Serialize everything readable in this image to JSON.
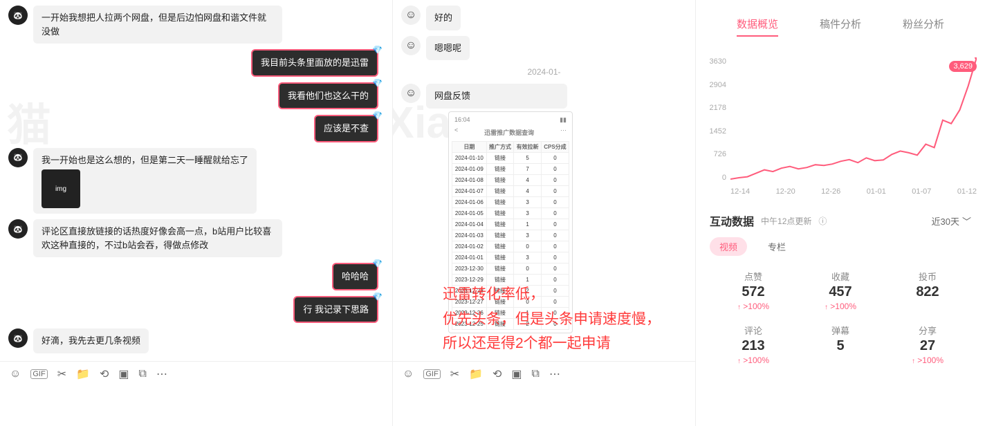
{
  "panel_a": {
    "messages": [
      {
        "side": "left",
        "style": "light",
        "text": "一开始我想把人拉两个网盘，但是后边怕网盘和谐文件就没做"
      },
      {
        "side": "right",
        "style": "dark",
        "text": "我目前头条里面放的是迅雷"
      },
      {
        "side": "right",
        "style": "dark",
        "text": "我看他们也这么干的"
      },
      {
        "side": "right",
        "style": "dark",
        "text": "应该是不查"
      },
      {
        "side": "left",
        "style": "light",
        "text": "我一开始也是这么想的，但是第二天一睡醒就给忘了",
        "has_image": true
      },
      {
        "side": "left",
        "style": "light",
        "text": "评论区直接放链接的话热度好像会高一点，b站用户比较喜欢这种直接的，不过b站会吞，得做点修改"
      },
      {
        "side": "right",
        "style": "dark",
        "text": "哈哈哈"
      },
      {
        "side": "right",
        "style": "dark",
        "text": "行  我记录下思路"
      },
      {
        "side": "left",
        "style": "light",
        "text": "好滴，我先去更几条视频"
      }
    ],
    "toolbar_icons": [
      "smile-icon",
      "gif-icon",
      "scissor-icon",
      "folder-icon",
      "history-icon",
      "image-icon",
      "screenshot-icon",
      "more-icon"
    ]
  },
  "panel_b": {
    "messages": [
      {
        "side": "left",
        "text": "好的"
      },
      {
        "side": "left",
        "text": "嗯嗯呢"
      }
    ],
    "timestamp": "2024-01-",
    "feedback_label": "网盘反馈",
    "phone": {
      "time": "16:04",
      "battery": "▮▮",
      "back": "<",
      "title": "迅雷推广数据查询",
      "more": "···",
      "headers": [
        "日期",
        "推广方式",
        "有效拉新",
        "CPS分成"
      ],
      "rows": [
        [
          "2024-01-10",
          "链接",
          "5",
          "0"
        ],
        [
          "2024-01-09",
          "链接",
          "7",
          "0"
        ],
        [
          "2024-01-08",
          "链接",
          "4",
          "0"
        ],
        [
          "2024-01-07",
          "链接",
          "4",
          "0"
        ],
        [
          "2024-01-06",
          "链接",
          "3",
          "0"
        ],
        [
          "2024-01-05",
          "链接",
          "3",
          "0"
        ],
        [
          "2024-01-04",
          "链接",
          "1",
          "0"
        ],
        [
          "2024-01-03",
          "链接",
          "3",
          "0"
        ],
        [
          "2024-01-02",
          "链接",
          "0",
          "0"
        ],
        [
          "2024-01-01",
          "链接",
          "3",
          "0"
        ],
        [
          "2023-12-30",
          "链接",
          "0",
          "0"
        ],
        [
          "2023-12-29",
          "链接",
          "1",
          "0"
        ],
        [
          "2023-12-28",
          "链接",
          "2",
          "0"
        ],
        [
          "2023-12-27",
          "链接",
          "0",
          "0"
        ],
        [
          "2023-12-26",
          "链接",
          "1",
          "0"
        ],
        [
          "2023-12-25",
          "链接",
          "2",
          "0"
        ]
      ]
    },
    "overlay": "迅雷转化率低，\n优先头条，但是头条申请速度慢，\n所以还是得2个都一起申请",
    "toolbar_icons": [
      "smile-icon",
      "gif-icon",
      "scissor-icon",
      "folder-icon",
      "history-icon",
      "image-icon",
      "screenshot-icon",
      "more-icon"
    ]
  },
  "analytics": {
    "tabs": [
      "数据概览",
      "稿件分析",
      "粉丝分析"
    ],
    "active_tab": 0,
    "peak_badge": "3,629",
    "chart_data": {
      "type": "line",
      "categories": [
        "12-14",
        "12-20",
        "12-26",
        "01-01",
        "01-07",
        "01-12"
      ],
      "y_ticks": [
        "3630",
        "2904",
        "2178",
        "1452",
        "726",
        "0"
      ],
      "values": [
        80,
        120,
        150,
        250,
        350,
        300,
        400,
        450,
        380,
        420,
        500,
        480,
        520,
        600,
        650,
        560,
        700,
        620,
        640,
        800,
        900,
        850,
        780,
        1100,
        1000,
        1800,
        1700,
        2100,
        2800,
        3629
      ],
      "title": "",
      "xlabel": "",
      "ylabel": "",
      "ylim": [
        0,
        3630
      ],
      "color": "#FF5C7C"
    },
    "inter_head": "互动数据",
    "inter_sub": "中午12点更新",
    "period": "近30天",
    "pill_tabs": [
      "视频",
      "专栏"
    ],
    "active_pill": 0,
    "metrics": [
      {
        "label": "点赞",
        "value": "572",
        "trend": ">100%"
      },
      {
        "label": "收藏",
        "value": "457",
        "trend": ">100%"
      },
      {
        "label": "投币",
        "value": "822",
        "trend": ""
      },
      {
        "label": "评论",
        "value": "213",
        "trend": ">100%"
      },
      {
        "label": "弹幕",
        "value": "5",
        "trend": ""
      },
      {
        "label": "分享",
        "value": "27",
        "trend": ">100%"
      }
    ]
  }
}
